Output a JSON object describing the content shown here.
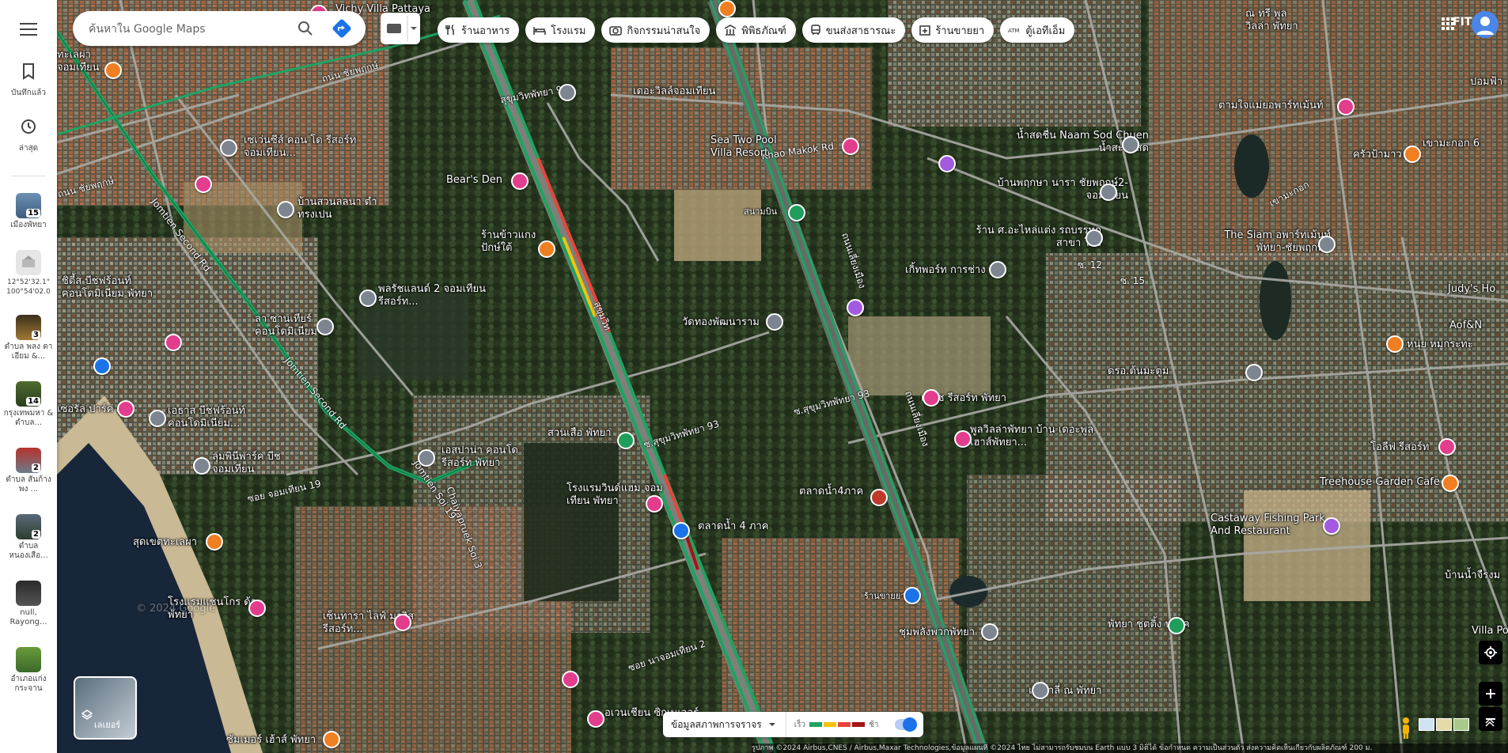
{
  "sidebar": {
    "saved_label": "บันทึกแล้ว",
    "recent_label": "ล่าสุด",
    "recents": [
      {
        "label": "เมืองพัทยา",
        "badge": "15"
      },
      {
        "label": "12°52'32.1\" 100°54'02.0",
        "badge": ""
      },
      {
        "label": "ตำบล พลง ตาเอียม &...",
        "badge": "3"
      },
      {
        "label": "กรุงเทพมหา & ตำบล...",
        "badge": "14"
      },
      {
        "label": "ตำบล สันก้างพง ...",
        "badge": "2"
      },
      {
        "label": "ตำบล หนองเสือ...",
        "badge": "2"
      },
      {
        "label": "null, Rayong...",
        "badge": ""
      },
      {
        "label": "อำเภอแก่ง กระจาน",
        "badge": ""
      }
    ]
  },
  "search": {
    "placeholder": "ค้นหาใน Google Maps"
  },
  "chips": [
    {
      "label": "ร้านอาหาร",
      "icon": "fork-knife-icon"
    },
    {
      "label": "โรงแรม",
      "icon": "bed-icon"
    },
    {
      "label": "กิจกรรมน่าสนใจ",
      "icon": "camera-icon"
    },
    {
      "label": "พิพิธภัณฑ์",
      "icon": "museum-icon"
    },
    {
      "label": "ขนส่งสาธารณะ",
      "icon": "bus-icon"
    },
    {
      "label": "ร้านขายยา",
      "icon": "pharmacy-icon"
    },
    {
      "label": "ตู้เอทีเอ็ม",
      "icon": "atm-icon"
    }
  ],
  "header": {
    "account_text": "FIT"
  },
  "layers": {
    "label": "เลเยอร์"
  },
  "traffic": {
    "label": "ข้อมูลสภาพการจราจร",
    "fast": "เร็ว",
    "slow": "ช้า"
  },
  "footer": {
    "text": "รูปภาพ ©2024 Airbus,CNES / Airbus,Maxar Technologies,ข้อมูลแผนที่ ©2024   ไทย   ไม่สามารถรับชมบน Earth แบบ 3 มิติได้   ข้อกำหนด   ความเป็นส่วนตัว   ส่งความคิดเห็นเกี่ยวกับผลิตภัณฑ์   200 ม."
  },
  "colors": {
    "accent": "#1a73e8",
    "traffic_green": "#1ea362",
    "traffic_yellow": "#f4c20d",
    "traffic_red": "#e8453c",
    "traffic_dark": "#a31515"
  },
  "map_labels": [
    {
      "t": "Vichy Villa Pattaya"
    },
    {
      "t": "ทะเลผ่า จอมเทียน"
    },
    {
      "t": "ถนน ชัยพฤกษ์"
    },
    {
      "t": "สุขุมวิทพัทยา 97"
    },
    {
      "t": "เดอะวิลล์จอมเทียน"
    },
    {
      "t": "เซเว่นซีส์ คอน โด รีสอร์ท จอมเทียน..."
    },
    {
      "t": "Sea Two Pool Villa Resort"
    },
    {
      "t": "น้ำสดชื่น Naam Sod Chuen น้ำสะโขสด"
    },
    {
      "t": "ตามใจแม่ยอพาร์ทเม้นท์"
    },
    {
      "t": "ครัวป้ามาว"
    },
    {
      "t": "Bear's Den"
    },
    {
      "t": "บ้านสวนลลนา ตำ ทรงเปน"
    },
    {
      "t": "บ้านพฤกษา นารา ชัยพฤกษ์2-จอมเทียน"
    },
    {
      "t": "ร้านข้าวแกง ปักษ์ใต้"
    },
    {
      "t": "สนามบิน"
    },
    {
      "t": "ร้าน ศ.อะไหล่แต่ง รถบรรทุก สาขา โป่ง"
    },
    {
      "t": "The Siam อพาร์ทเม้นท์ พัทยา-ชัยพฤกษ์2"
    },
    {
      "t": "เกิ้ทพอร์ท การช่าง"
    },
    {
      "t": "ซิตี้ส บีชฟร้อนท์ คอนโดมิเนียม พัทยา"
    },
    {
      "t": "พลรัชแลนด์ 2 จอมเทียน รีสอร์ท..."
    },
    {
      "t": "Judy's Ho"
    },
    {
      "t": "ลา ซานเทียร์ คอนโดมิเนียม"
    },
    {
      "t": "วัดทองพัฒนาราม"
    },
    {
      "t": "หนุ่ย หมูกระทะ"
    },
    {
      "t": "Aof&N"
    },
    {
      "t": "ดรอ.ต้นมะตูม"
    },
    {
      "t": "เอธาส บีชฟร้อนท์ คอนโดมิเนียม..."
    },
    {
      "t": "เฟรช รีสอร์ท พัทยา"
    },
    {
      "t": "เซอรัล ปาร์ค"
    },
    {
      "t": "พูลวิลล่าพัทยา บ้าน เดอะพูลเฮาส์พัทยา..."
    },
    {
      "t": "สวนเสือ พัทยา"
    },
    {
      "t": "เอสปาน่า คอนโด รีสอร์ท พัทยา"
    },
    {
      "t": "ลุมพินีพาร์ค บีช จอมเทียน"
    },
    {
      "t": "ตลาดน้ำ4ภาค"
    },
    {
      "t": "โอลีฟ รีสอร์ท"
    },
    {
      "t": "Treehouse Garden Cafe"
    },
    {
      "t": "โรงแรมวินด์แฮม จอมเทียน พัทยา"
    },
    {
      "t": "ตลาดน้ำ 4 ภาค"
    },
    {
      "t": "Castaway Fishing Park And Restaurant"
    },
    {
      "t": "สุดเขตทะเลผา"
    },
    {
      "t": "บ้านน้ำจืรงม"
    },
    {
      "t": "ร้านขายยา"
    },
    {
      "t": "โรงแรมแชนโกร ด้า พัทยา"
    },
    {
      "t": "เซ็นทารา ไลฟ์ มาริส รีสอร์ท..."
    },
    {
      "t": "ชุมพลังพวกพัทยา"
    },
    {
      "t": "พัทยา ชูตติ้ง ปาร์ค"
    },
    {
      "t": "Villa Po"
    },
    {
      "t": "แม่กาลี่ ณ พัทยา"
    },
    {
      "t": "อเวนเชียน ซิกเนเจอร์"
    },
    {
      "t": "ซัมเมอร์ เฮ้าส์ พัทยา"
    },
    {
      "t": "ณ ทรี พูล วิลล่า พัทยา"
    },
    {
      "t": "ปอมฟ้า"
    },
    {
      "t": "เขามะกอก 6"
    },
    {
      "t": "Jomtien Second Rd"
    },
    {
      "t": "สุขุมวิท"
    },
    {
      "t": "ซ.สุขุมวิทพัทยา 93"
    },
    {
      "t": "ถนนเลี่ยงเมือง"
    },
    {
      "t": "Chaiyapruek Soi 3"
    },
    {
      "t": "Jomtien Soi 19"
    },
    {
      "t": "ซอย จอมเทียน 19"
    },
    {
      "t": "ซอย นาจอมเทียน 2"
    },
    {
      "t": "Khao Makok Rd"
    },
    {
      "t": "เขามะกอก"
    },
    {
      "t": "ถนน ชัยพฤกษ์"
    },
    {
      "t": "© 2024 Google"
    },
    {
      "t": "ซ. 12"
    },
    {
      "t": "ซ. 15"
    }
  ]
}
